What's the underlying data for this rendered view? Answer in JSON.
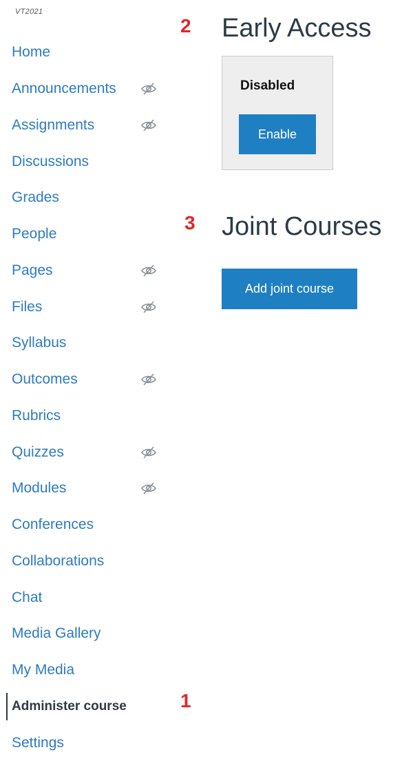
{
  "term": "VT2021",
  "nav": {
    "items": [
      {
        "label": "Home",
        "hidden": false,
        "active": false
      },
      {
        "label": "Announcements",
        "hidden": true,
        "active": false
      },
      {
        "label": "Assignments",
        "hidden": true,
        "active": false
      },
      {
        "label": "Discussions",
        "hidden": false,
        "active": false
      },
      {
        "label": "Grades",
        "hidden": false,
        "active": false
      },
      {
        "label": "People",
        "hidden": false,
        "active": false
      },
      {
        "label": "Pages",
        "hidden": true,
        "active": false
      },
      {
        "label": "Files",
        "hidden": true,
        "active": false
      },
      {
        "label": "Syllabus",
        "hidden": false,
        "active": false
      },
      {
        "label": "Outcomes",
        "hidden": true,
        "active": false
      },
      {
        "label": "Rubrics",
        "hidden": false,
        "active": false
      },
      {
        "label": "Quizzes",
        "hidden": true,
        "active": false
      },
      {
        "label": "Modules",
        "hidden": true,
        "active": false
      },
      {
        "label": "Conferences",
        "hidden": false,
        "active": false
      },
      {
        "label": "Collaborations",
        "hidden": false,
        "active": false
      },
      {
        "label": "Chat",
        "hidden": false,
        "active": false
      },
      {
        "label": "Media Gallery",
        "hidden": false,
        "active": false
      },
      {
        "label": "My Media",
        "hidden": false,
        "active": false
      },
      {
        "label": "Administer course",
        "hidden": false,
        "active": true
      },
      {
        "label": "Settings",
        "hidden": false,
        "active": false
      }
    ]
  },
  "markers": {
    "one": "1",
    "two": "2",
    "three": "3"
  },
  "early_access": {
    "title": "Early Access",
    "status": "Disabled",
    "button": "Enable"
  },
  "joint_courses": {
    "title": "Joint Courses",
    "button": "Add joint course"
  },
  "colors": {
    "link": "#2d7bbf",
    "button": "#1f7fc3",
    "marker": "#e0262b",
    "text": "#2d3b45"
  },
  "icons": {
    "hidden_indicator": "eye-slash-icon"
  }
}
